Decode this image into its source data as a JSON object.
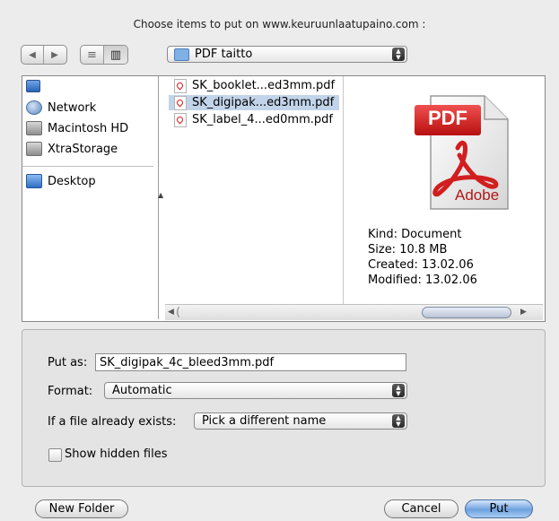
{
  "title": "Choose items to put on www.keuruunlaatupaino.com :",
  "nav": {
    "back_icon": "◀",
    "forward_icon": "▶"
  },
  "view": {
    "list_icon": "≡",
    "column_icon": "▥"
  },
  "location": {
    "folder_name": "PDF taitto"
  },
  "sidebar": {
    "items": [
      {
        "label": "Network",
        "icon": "globe-icon"
      },
      {
        "label": "Macintosh HD",
        "icon": "hard-disk-icon"
      },
      {
        "label": "XtraStorage",
        "icon": "hard-disk-icon"
      },
      {
        "label": "Desktop",
        "icon": "desktop-icon"
      }
    ]
  },
  "files": [
    {
      "name": "SK_booklet...ed3mm.pdf",
      "selected": false
    },
    {
      "name": "SK_digipak...ed3mm.pdf",
      "selected": true
    },
    {
      "name": "SK_label_4...ed0mm.pdf",
      "selected": false
    }
  ],
  "preview": {
    "icon_text": "PDF",
    "brand": "Adobe",
    "kind": "Kind: Document",
    "size": "Size: 10.8 MB",
    "created": "Created: 13.02.06",
    "modified": "Modified: 13.02.06"
  },
  "form": {
    "put_as_label": "Put as:",
    "put_as_value": "SK_digipak_4c_bleed3mm.pdf",
    "format_label": "Format:",
    "format_value": "Automatic",
    "exists_label": "If a file already exists:",
    "exists_value": "Pick a different name",
    "hidden_label": "Show hidden files",
    "hidden_checked": false
  },
  "buttons": {
    "new_folder": "New Folder",
    "cancel": "Cancel",
    "put": "Put"
  },
  "colors": {
    "selection": "#c2d4ea",
    "default_button": "#6ea1de",
    "pdf_red": "#d11e1e"
  }
}
